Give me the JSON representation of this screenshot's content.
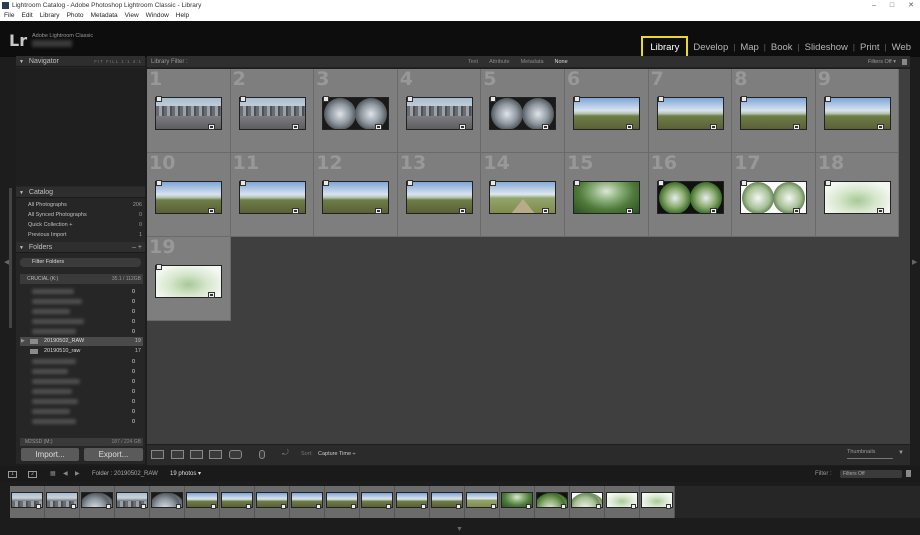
{
  "window": {
    "title": "Lightroom Catalog - Adobe Photoshop Lightroom Classic - Library",
    "controls": [
      "–",
      "□",
      "✕"
    ]
  },
  "menu": [
    "File",
    "Edit",
    "Library",
    "Photo",
    "Metadata",
    "View",
    "Window",
    "Help"
  ],
  "identity": {
    "logo": "Lr",
    "product": "Adobe Lightroom Classic"
  },
  "modules": [
    "Library",
    "Develop",
    "Map",
    "Book",
    "Slideshow",
    "Print",
    "Web"
  ],
  "left_panel": {
    "navigator": {
      "title": "Navigator",
      "zoom_options": "FIT FILL 1:1 4:1"
    },
    "catalog": {
      "title": "Catalog",
      "items": [
        {
          "label": "All Photographs",
          "count": "206"
        },
        {
          "label": "All Synced Photographs",
          "count": "0"
        },
        {
          "label": "Quick Collection +",
          "count": "0"
        },
        {
          "label": "Previous Import",
          "count": "1"
        }
      ]
    },
    "folders": {
      "title": "Folders",
      "filter_placeholder": "Filter Folders",
      "volume": {
        "name": "CRUCIAL (K:)",
        "size": "35.1 / 112GB"
      },
      "folder_rows": [
        {
          "label": "20190502_RAW",
          "count": "19",
          "selected": true
        },
        {
          "label": "20190510_raw",
          "count": "17",
          "selected": false
        }
      ],
      "blur_counts": [
        "0",
        "0",
        "0",
        "0",
        "0",
        "0",
        "0",
        "0",
        "0",
        "0",
        "0",
        "0"
      ],
      "volume2": {
        "name": "M2SSD (M:)",
        "size": "187 / 224 GB"
      }
    },
    "import_label": "Import...",
    "export_label": "Export..."
  },
  "filter_bar": {
    "label": "Library Filter :",
    "options": [
      "Text",
      "Attribute",
      "Metadata",
      "None"
    ],
    "active": "None",
    "filters_off": "Filters Off ▾"
  },
  "grid": {
    "cells": [
      {
        "n": "1",
        "kind": "city"
      },
      {
        "n": "2",
        "kind": "city"
      },
      {
        "n": "3",
        "kind": "fish"
      },
      {
        "n": "4",
        "kind": "city"
      },
      {
        "n": "5",
        "kind": "fish"
      },
      {
        "n": "6",
        "kind": "field"
      },
      {
        "n": "7",
        "kind": "field"
      },
      {
        "n": "8",
        "kind": "field"
      },
      {
        "n": "9",
        "kind": "field"
      },
      {
        "n": "10",
        "kind": "field"
      },
      {
        "n": "11",
        "kind": "field"
      },
      {
        "n": "12",
        "kind": "field"
      },
      {
        "n": "13",
        "kind": "field"
      },
      {
        "n": "14",
        "kind": "road"
      },
      {
        "n": "15",
        "kind": "forest"
      },
      {
        "n": "16",
        "kind": "fishg"
      },
      {
        "n": "17",
        "kind": "fishw"
      },
      {
        "n": "18",
        "kind": "tree"
      },
      {
        "n": "19",
        "kind": "tree"
      }
    ]
  },
  "toolbar": {
    "sort_label": "Sort:",
    "sort_value": "Capture Time ÷",
    "thumbnails_label": "Thumbnails"
  },
  "secondary": {
    "monitor1": "1",
    "monitor2": "2",
    "folder_path": "Folder : 20190502_RAW",
    "photo_count": "19 photos ▾",
    "filter_label": "Filter :",
    "filter_value": "Filters Off"
  },
  "colors": {
    "accent_highlight": "#e8da2a",
    "grid_cell": "#7e7e7e",
    "background": "#1d1d1d"
  }
}
